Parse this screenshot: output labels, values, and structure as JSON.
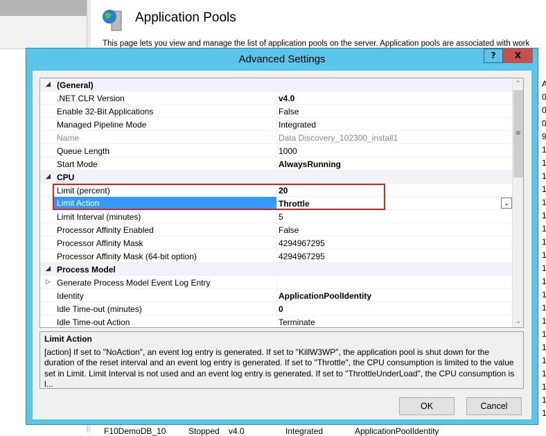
{
  "background": {
    "page_title": "Application Pools",
    "description": "This page lets you view and manage the list of application pools on the server. Application pools are associated with work",
    "right_column": [
      "A",
      "0",
      "0",
      "0",
      "9",
      "1",
      "1",
      "1",
      "1",
      "1",
      "1",
      "1",
      "1",
      "1",
      "1",
      "1",
      "1",
      "1",
      "1",
      "1",
      "1",
      "1",
      "1",
      "1",
      "1",
      "1"
    ],
    "bottom_row": [
      "F10DemoDB_10",
      "Stopped",
      "v4.0",
      "Integrated",
      "ApplicationPoolIdentity"
    ]
  },
  "dialog": {
    "title": "Advanced Settings",
    "help_label": "?",
    "close_label": "X",
    "rows": [
      {
        "type": "cat",
        "name": "(General)"
      },
      {
        "name": ".NET CLR Version",
        "value": "v4.0",
        "bold": true
      },
      {
        "name": "Enable 32-Bit Applications",
        "value": "False"
      },
      {
        "name": "Managed Pipeline Mode",
        "value": "Integrated"
      },
      {
        "name": "Name",
        "value": "Data Discovery_102300_install1",
        "disabled": true
      },
      {
        "name": "Queue Length",
        "value": "1000"
      },
      {
        "name": "Start Mode",
        "value": "AlwaysRunning",
        "bold": true
      },
      {
        "type": "cat",
        "name": "CPU"
      },
      {
        "name": "Limit (percent)",
        "value": "20",
        "bold": true
      },
      {
        "name": "Limit Action",
        "value": "Throttle",
        "bold": true,
        "selected": true
      },
      {
        "name": "Limit Interval (minutes)",
        "value": "5"
      },
      {
        "name": "Processor Affinity Enabled",
        "value": "False"
      },
      {
        "name": "Processor Affinity Mask",
        "value": "4294967295"
      },
      {
        "name": "Processor Affinity Mask (64-bit option)",
        "value": "4294967295"
      },
      {
        "type": "cat",
        "name": "Process Model"
      },
      {
        "name": "Generate Process Model Event Log Entry",
        "value": "",
        "collapsed": true
      },
      {
        "name": "Identity",
        "value": "ApplicationPoolIdentity",
        "bold": true
      },
      {
        "name": "Idle Time-out (minutes)",
        "value": "0",
        "bold": true
      },
      {
        "name": "Idle Time-out Action",
        "value": "Terminate"
      }
    ],
    "help_title": "Limit Action",
    "help_text": "[action] If set to \"NoAction\", an event log entry is generated.  If set to \"KillW3WP\", the application pool is shut down for the duration of the reset interval and an event log entry is generated. If set to \"Throttle\", the CPU consumption is limited to the value set in Limit. Limit Interval is not used and an event log entry is generated. If set to \"ThrottleUnderLoad\", the CPU consumption is l...",
    "ok_label": "OK",
    "cancel_label": "Cancel"
  }
}
